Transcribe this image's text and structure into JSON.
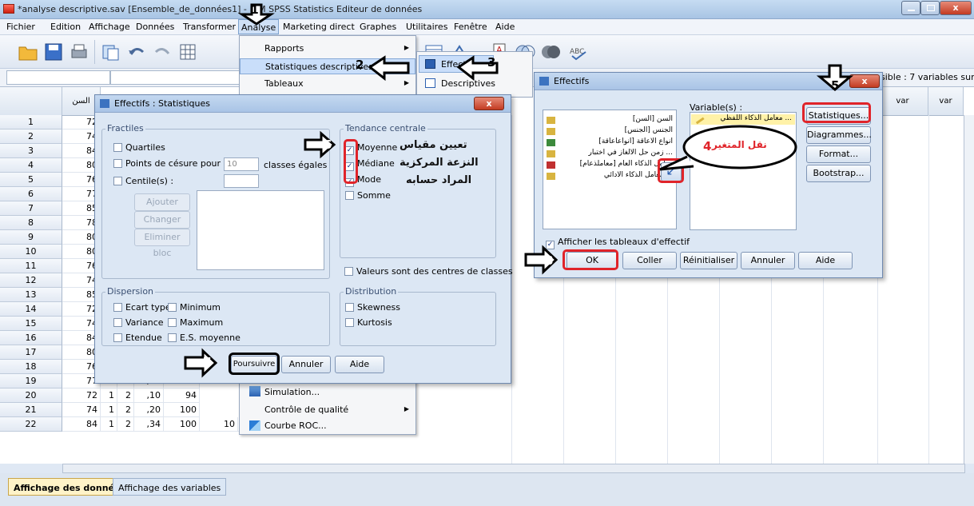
{
  "window": {
    "title": "*analyse descriptive.sav [Ensemble_de_données1] - IBM SPSS Statistics Editeur de données"
  },
  "menubar": [
    "Fichier",
    "Edition",
    "Affichage",
    "Données",
    "Transformer",
    "Analyse",
    "Marketing direct",
    "Graphes",
    "Utilitaires",
    "Fenêtre",
    "Aide"
  ],
  "visible_info": "sible : 7 variables sur 7",
  "grid": {
    "headers": [
      "السن",
      "var",
      "var"
    ],
    "rows": [
      "1",
      "2",
      "3",
      "4",
      "5",
      "6",
      "7",
      "8",
      "9",
      "10",
      "11",
      "12",
      "13",
      "14",
      "15",
      "16",
      "17",
      "18",
      "19",
      "20",
      "21",
      "22"
    ],
    "col1": [
      "72",
      "74",
      "84",
      "80",
      "76",
      "77",
      "85",
      "78",
      "80",
      "80",
      "76",
      "74",
      "85",
      "72",
      "74",
      "84",
      "80",
      "76",
      "77",
      "72",
      "74",
      "84"
    ],
    "tail": [
      [
        "2",
        "2",
        ",40",
        "92"
      ],
      [
        "2",
        "1",
        ",54",
        "45"
      ],
      [
        "1",
        "2",
        ",10",
        "94"
      ],
      [
        "1",
        "2",
        ",20",
        "100"
      ],
      [
        "1",
        "2",
        ",34",
        "100",
        "10",
        "20"
      ]
    ]
  },
  "tabs": {
    "data_view": "Affichage des données",
    "variable_view": "Affichage des variables"
  },
  "analyse_menu": {
    "rapports": "Rapports",
    "stats_desc": "Statistiques descriptives",
    "tableaux": "Tableaux",
    "simulation": "Simulation...",
    "qualite": "Contrôle de qualité",
    "roc": "Courbe ROC..."
  },
  "submenu": {
    "effectifs": "Effectifs",
    "descriptives": "Descriptives"
  },
  "effectifs_dialog": {
    "title": "Effectifs",
    "variables_label": "Variable(s) :",
    "source_vars": [
      "السن [السن]",
      "الجنس [الجنس]",
      "أنواع الاعاقة [أنواعاعاقة]",
      "زمن حل الألغاز في اختبار ...",
      "معامل الذكاء العام [معاملذعام]",
      "معامل الذكاء الأدائي ..."
    ],
    "target_var": "معامل الذكاء اللفظي ...",
    "buttons": {
      "statistiques": "Statistiques...",
      "diagrammes": "Diagrammes...",
      "format": "Format...",
      "bootstrap": "Bootstrap..."
    },
    "show_tables": "Afficher les tableaux d'effectif",
    "bottom": {
      "ok": "OK",
      "coller": "Coller",
      "reinit": "Réinitialiser",
      "annuler": "Annuler",
      "aide": "Aide"
    }
  },
  "stats_dialog": {
    "title": "Effectifs : Statistiques",
    "fractiles": {
      "label": "Fractiles",
      "quartiles": "Quartiles",
      "cesure": "Points de césure pour :",
      "cesure_value": "10",
      "classes": "classes égales",
      "centiles": "Centile(s) :",
      "ajouter": "Ajouter",
      "changer": "Changer",
      "eliminer": "Eliminer bloc"
    },
    "tendance": {
      "label": "Tendance centrale",
      "moyenne": "Moyenne",
      "mediane": "Médiane",
      "mode": "Mode",
      "somme": "Somme"
    },
    "valeurs_centres": "Valeurs sont des centres de classes",
    "dispersion": {
      "label": "Dispersion",
      "ecart": "Ecart type",
      "minimum": "Minimum",
      "variance": "Variance",
      "maximum": "Maximum",
      "etendue": "Etendue",
      "es": "E.S. moyenne"
    },
    "distribution": {
      "label": "Distribution",
      "skewness": "Skewness",
      "kurtosis": "Kurtosis"
    },
    "buttons": {
      "poursuivre": "Poursuivre",
      "annuler": "Annuler",
      "aide": "Aide"
    }
  },
  "annotations": {
    "steps": [
      "1",
      "2",
      "3",
      "4",
      "5",
      "6",
      "7",
      "8"
    ],
    "step4_text": "نقل المتغير",
    "step6_lines": [
      "تعيين مقياس",
      "النزعة المركزية",
      "المراد حسابه"
    ]
  },
  "colors": {
    "accent_red": "#e0242a",
    "highlight": "#c9defa",
    "tab_active": "#fff3c8"
  }
}
